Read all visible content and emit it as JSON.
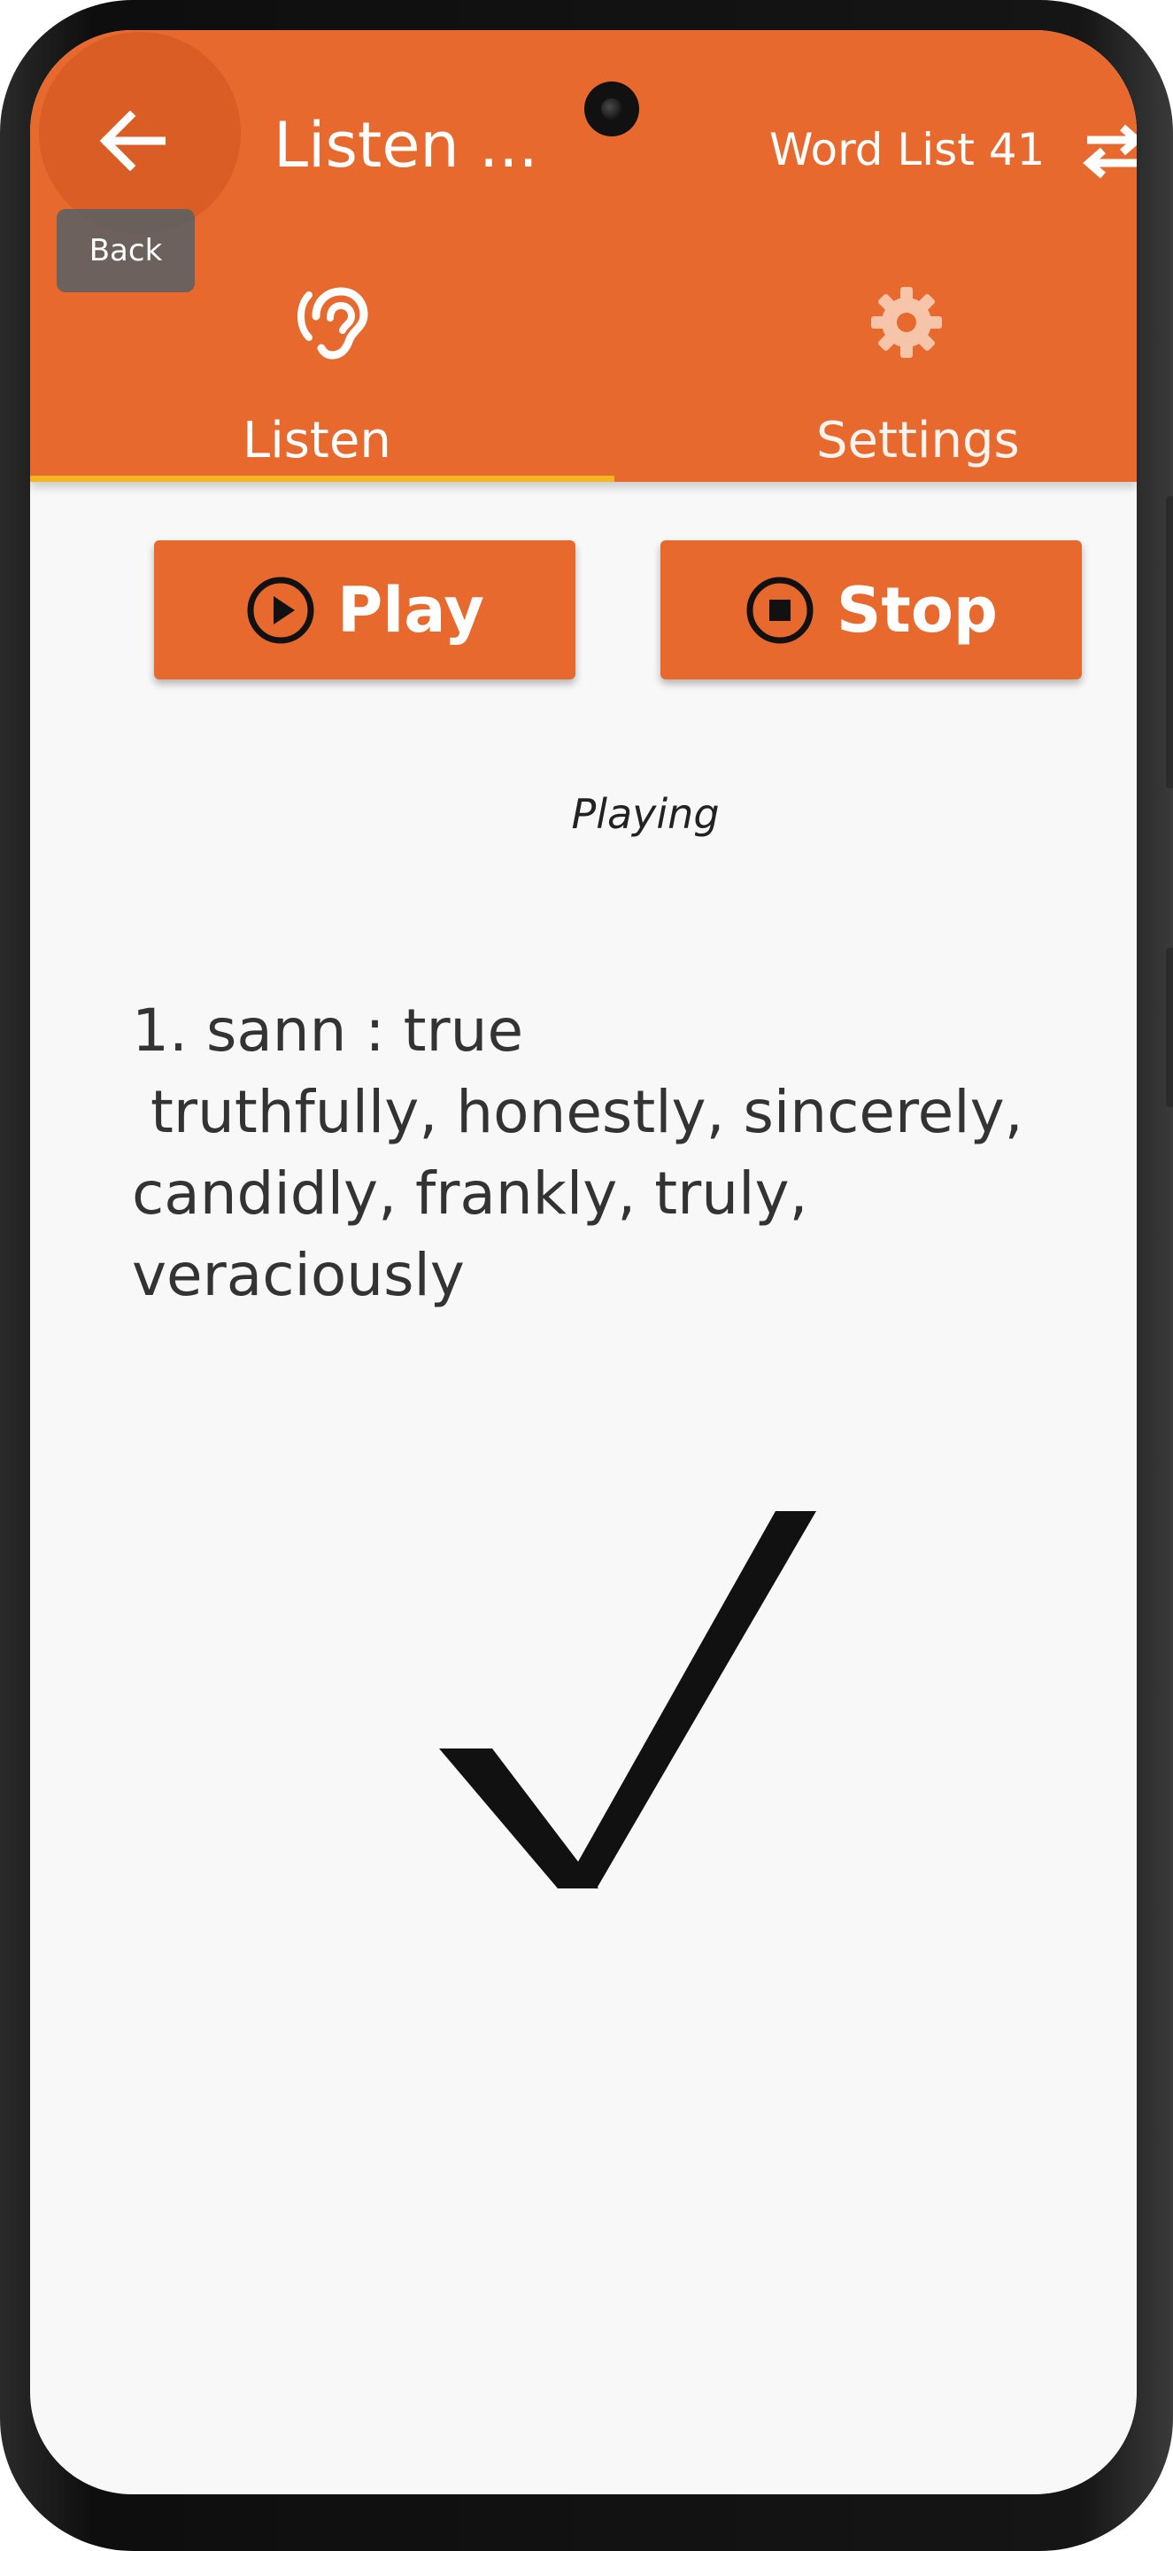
{
  "appbar": {
    "title": "Listen ...",
    "list_name": "Word List 41",
    "back_tooltip": "Back",
    "background_color": "#e8692e"
  },
  "tabs": [
    {
      "label": "Listen",
      "icon": "ear-icon",
      "selected": true
    },
    {
      "label": "Settings",
      "icon": "gear-icon",
      "selected": false
    }
  ],
  "controls": {
    "play_label": "Play",
    "stop_label": "Stop"
  },
  "status": "Playing",
  "word": {
    "text": "1. sann : true\n truthfully, honestly, sincerely,\ncandidly, frankly, truly,\nveraciously"
  },
  "feedback": {
    "icon": "checkmark-icon"
  },
  "colors": {
    "accent": "#e8692e",
    "indicator": "#f6b420",
    "background": "#f8f8f8"
  }
}
